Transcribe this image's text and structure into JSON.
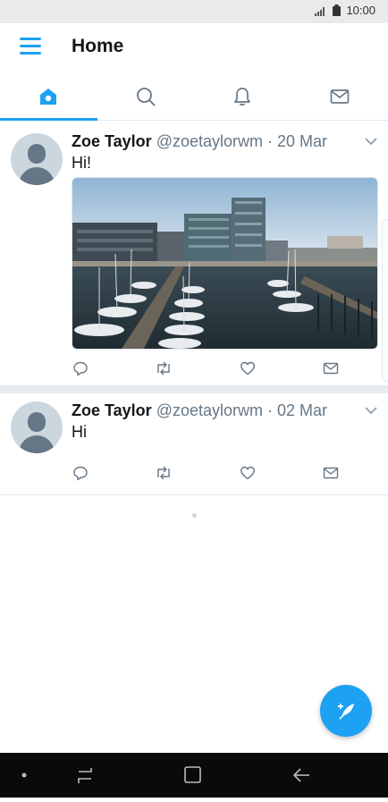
{
  "status_bar": {
    "time": "10:00"
  },
  "app_bar": {
    "title": "Home",
    "menu_icon": "hamburger-menu-icon"
  },
  "tabs": [
    {
      "name": "home",
      "icon": "home-icon",
      "active": true
    },
    {
      "name": "search",
      "icon": "search-icon",
      "active": false
    },
    {
      "name": "notifications",
      "icon": "bell-icon",
      "active": false
    },
    {
      "name": "messages",
      "icon": "mail-icon",
      "active": false
    }
  ],
  "tweets": [
    {
      "name": "Zoe Taylor",
      "handle_date": "@zoetaylorwm · 20 Mar",
      "text": "Hi!",
      "has_media": true
    },
    {
      "name": "Zoe Taylor",
      "handle_date": "@zoetaylorwm · 02 Mar",
      "text": "Hi",
      "has_media": false
    }
  ],
  "colors": {
    "accent": "#1da1f2",
    "secondary_text": "#657786"
  }
}
